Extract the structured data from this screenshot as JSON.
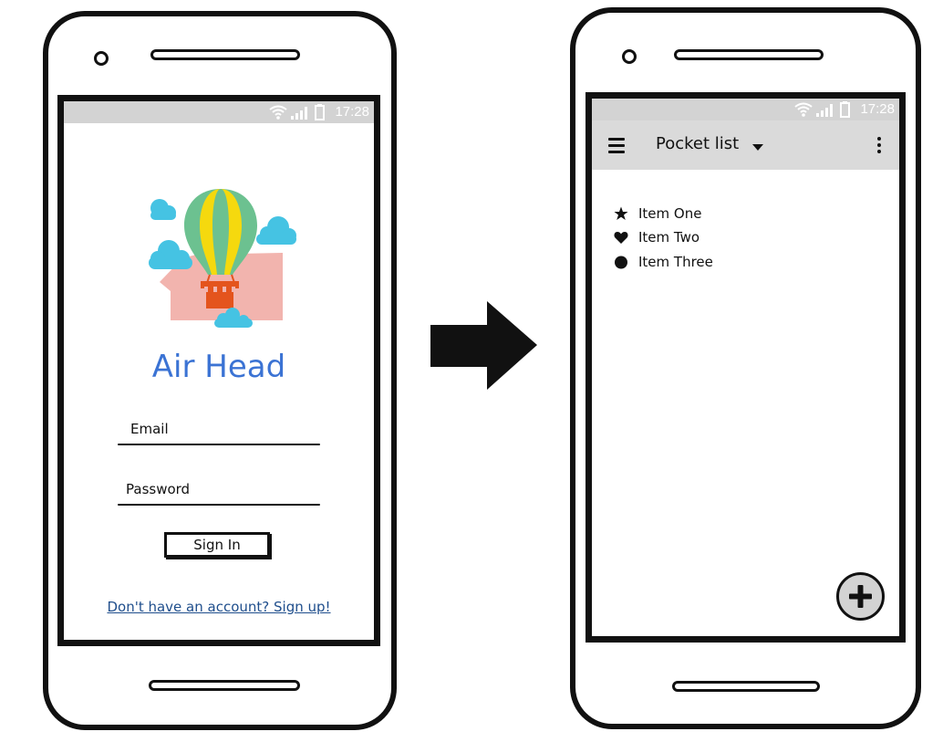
{
  "status_bar": {
    "time": "17:28"
  },
  "login_screen": {
    "app_title": "Air Head",
    "email_label": "Email",
    "password_label": "Password",
    "signin_button": "Sign In",
    "signup_link": "Don't have an account? Sign up!"
  },
  "list_screen": {
    "toolbar_title": "Pocket list",
    "items": [
      {
        "label": "Item One",
        "icon": "star-icon"
      },
      {
        "label": "Item Two",
        "icon": "heart-icon"
      },
      {
        "label": "Item Three",
        "icon": "circle-icon"
      }
    ],
    "fab_icon": "plus-icon"
  },
  "colors": {
    "title_blue": "#3b73d4",
    "link_blue": "#1f4e8c",
    "status_bar": "#d3d3d3",
    "toolbar": "#dadada",
    "balloon_green": "#6cc190",
    "balloon_yellow": "#f5d90e",
    "cloud_blue": "#45c3e3",
    "head_pink": "#f2b4ae",
    "basket_orange": "#e4541d"
  }
}
